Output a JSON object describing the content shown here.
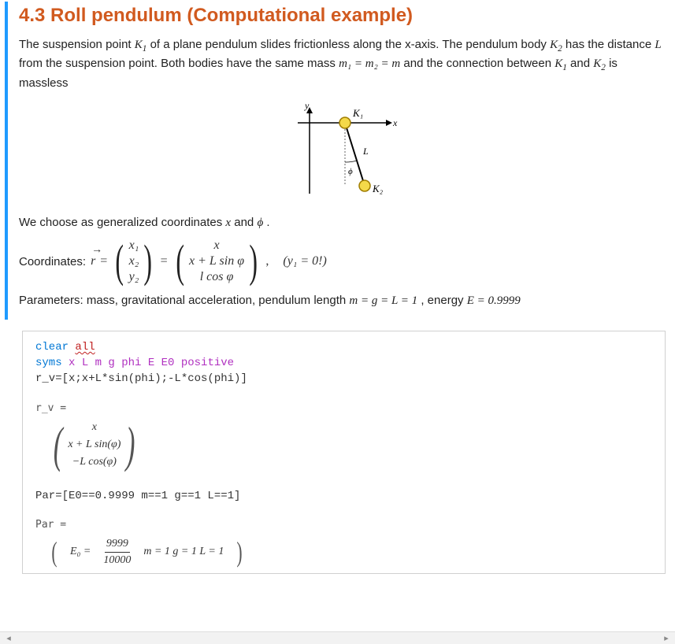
{
  "section": {
    "title": "4.3 Roll pendulum (Computational example)"
  },
  "text": {
    "intro_p1_a": "The suspension point ",
    "K1": "K",
    "K1_sub": "1",
    "intro_p1_b": " of a plane pendulum slides frictionless along the x-axis. The pendulum body ",
    "K2": "K",
    "K2_sub": "2",
    "intro_p1_c": " has the distance ",
    "L": "L",
    "intro_p1_d": " from the suspension point. Both bodies have the same mass ",
    "mass_eq": "m₁ = m₂ = m",
    "intro_p1_e": " and the connection between ",
    "intro_p1_f": " and ",
    "intro_p1_g": " is massless",
    "gc_a": "We choose as generalized coordinates ",
    "gc_x": "x",
    "gc_b": " and ",
    "gc_phi": "ϕ",
    "gc_c": " .",
    "coord_label": "Coordinates: ",
    "r": "r",
    "eq": " = ",
    "v11": "x₁",
    "v12": "x₂",
    "v13": "y₂",
    "v21": "x",
    "v22": "x + L sin φ",
    "v23": "l cos φ",
    "y1note": "(y₁ = 0!)",
    "params_a": "Parameters: mass, gravitational acceleration, pendulum length ",
    "params_eq1": "m = g = L = 1",
    "params_b": ", energy ",
    "params_eq2": "E = 0.9999"
  },
  "diagram": {
    "y_label": "y",
    "x_label": "x",
    "K1_label": "K₁",
    "K2_label": "K₂",
    "L_label": "L",
    "phi_label": "ϕ"
  },
  "code": {
    "l1a": "clear ",
    "l1b": "all",
    "l2a": "syms ",
    "l2b": "x L m g phi E E0 positive",
    "l3": "r_v=[x;x+L*sin(phi);-L*cos(phi)]",
    "out1_label": "r_v =",
    "out1_r1": "x",
    "out1_r2": "x + L sin(φ)",
    "out1_r3": "−L cos(φ)",
    "l4": "Par=[E0==0.9999 m==1 g==1 L==1]",
    "out2_label": "Par =",
    "out2_E0": "E₀ =",
    "out2_frac_num": "9999",
    "out2_frac_den": "10000",
    "out2_rest": "m = 1   g = 1   L = 1"
  }
}
